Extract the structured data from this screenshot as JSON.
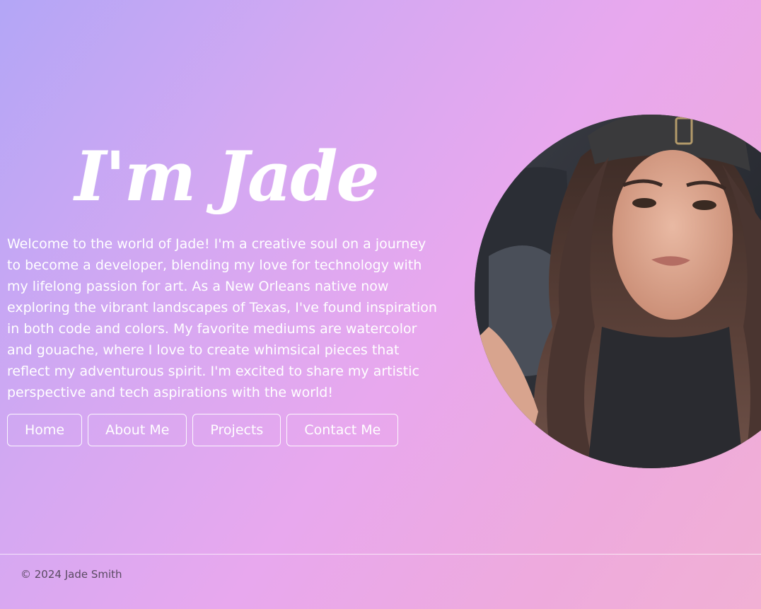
{
  "hero": {
    "title": "I'm Jade",
    "intro": "Welcome to the world of Jade! I'm a creative soul on a journey to become a developer, blending my love for technology with my lifelong passion for art. As a New Orleans native now exploring the vibrant landscapes of Texas, I've found inspiration in both code and colors. My favorite mediums are watercolor and gouache, where I love to create whimsical pieces that reflect my adventurous spirit. I'm excited to share my artistic perspective and tech aspirations with the world!"
  },
  "nav": {
    "items": [
      {
        "label": "Home"
      },
      {
        "label": "About Me"
      },
      {
        "label": "Projects"
      },
      {
        "label": "Contact Me"
      }
    ]
  },
  "footer": {
    "copyright": "© 2024 Jade Smith"
  },
  "colors": {
    "background_start": "#b3a6f6",
    "background_mid": "#e8a8ee",
    "background_end": "#f1b0d4",
    "text": "#ffffff",
    "footer_text": "#5a4a62"
  }
}
